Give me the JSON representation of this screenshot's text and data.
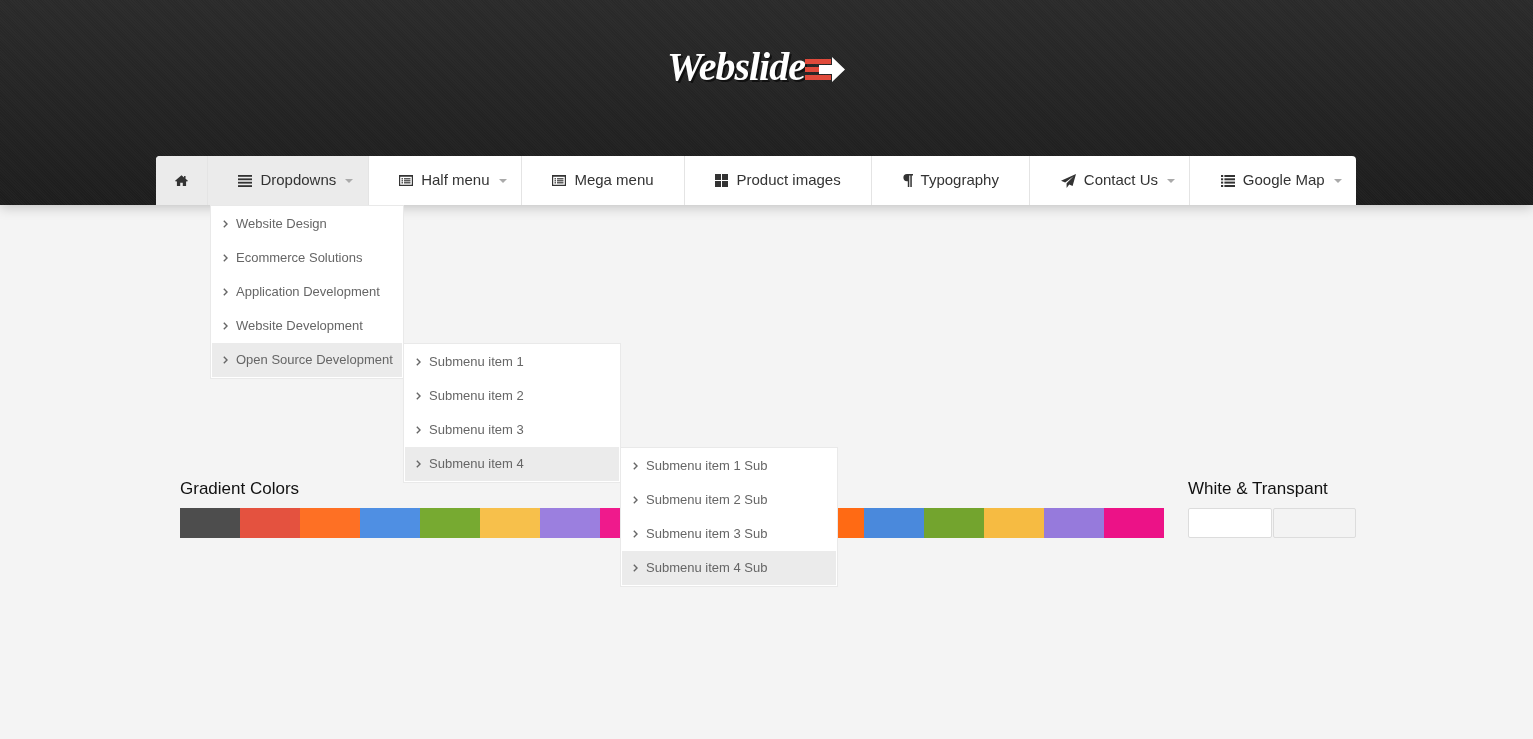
{
  "logo": {
    "text": "Webslide"
  },
  "nav": {
    "items": [
      {
        "kind": "home"
      },
      {
        "kind": "link",
        "label": "Dropdowns",
        "expanded": true,
        "has_menu": true,
        "children": [
          {
            "label": "Website Design",
            "selected": false
          },
          {
            "label": "Ecommerce Solutions",
            "selected": false
          },
          {
            "label": "Application Development",
            "selected": false
          },
          {
            "label": "Website Development",
            "selected": false
          },
          {
            "label": "Open Source Development",
            "selected": true,
            "children": [
              {
                "label": "Submenu item 1",
                "selected": false
              },
              {
                "label": "Submenu item 2",
                "selected": false
              },
              {
                "label": "Submenu item 3",
                "selected": false
              },
              {
                "label": "Submenu item 4",
                "selected": true,
                "children": [
                  {
                    "label": "Submenu item 1 Sub",
                    "selected": false
                  },
                  {
                    "label": "Submenu item 2 Sub",
                    "selected": false
                  },
                  {
                    "label": "Submenu item 3 Sub",
                    "selected": false
                  },
                  {
                    "label": "Submenu item 4 Sub",
                    "selected": true
                  }
                ]
              }
            ]
          }
        ]
      },
      {
        "kind": "link",
        "label": "Half menu",
        "expanded": false,
        "has_menu": true
      },
      {
        "kind": "link",
        "label": "Mega menu",
        "expanded": false,
        "has_menu": false
      },
      {
        "kind": "link",
        "label": "Product images",
        "expanded": false,
        "has_menu": false
      },
      {
        "kind": "link",
        "label": "Typography",
        "expanded": false,
        "has_menu": false
      },
      {
        "kind": "link",
        "label": "Contact Us",
        "expanded": false,
        "has_menu": true
      },
      {
        "kind": "link",
        "label": "Google Map",
        "expanded": false,
        "has_menu": true
      }
    ]
  },
  "gradient_colors": {
    "title": "Gradient Colors",
    "segments": [
      {
        "swatches": [
          {
            "color": "#4d4d4d"
          },
          {
            "color": "#e4523f"
          },
          {
            "color": "#fe7024"
          },
          {
            "color": "#4f8fe3"
          },
          {
            "color": "#77aa31"
          },
          {
            "color": "#f7c04b"
          },
          {
            "color": "#9b7fdf"
          },
          {
            "color": "#ef1a8c"
          }
        ]
      },
      {
        "swatches": [
          {
            "color": "#ff6a14"
          },
          {
            "color": "#4a89dc"
          },
          {
            "color": "#73a42e"
          },
          {
            "color": "#f6bb42"
          },
          {
            "color": "#967adc"
          },
          {
            "color": "#ec1287"
          }
        ]
      }
    ]
  },
  "white_transparent": {
    "title": "White & Transpant",
    "swatches": [
      {
        "color": "#ffffff"
      },
      {
        "color": "#f3f3f3"
      }
    ]
  }
}
